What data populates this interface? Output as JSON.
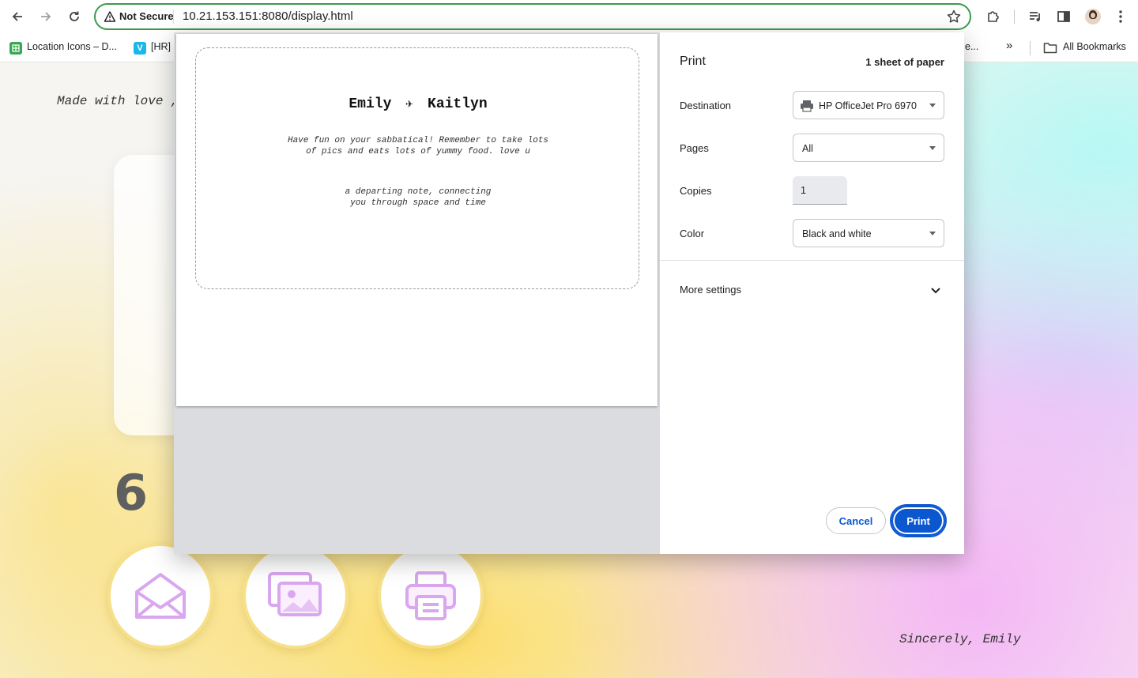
{
  "browser": {
    "security_label": "Not Secure",
    "url": "10.21.153.151:8080/display.html"
  },
  "bookmarks": {
    "items": [
      {
        "label": "Location Icons – D...",
        "favicon_letter": "",
        "color": "#34a853"
      },
      {
        "label": "[HR]",
        "favicon_letter": "V",
        "color": "#1ab7ea"
      }
    ],
    "truncated_label": "e...",
    "overflow_label": "»",
    "all_bookmarks_label": "All Bookmarks"
  },
  "page": {
    "made_with": "Made with love ,",
    "clock": "6 :",
    "sincerely": "Sincerely, Emily",
    "circle_icons": [
      "envelope-icon",
      "photos-icon",
      "printer-icon"
    ]
  },
  "print_preview": {
    "from_name": "Emily",
    "plane_glyph": "✈",
    "to_name": "Kaitlyn",
    "note": "Have fun on your sabbatical! Remember to take lots of pics and eats lots of yummy food. love u",
    "tagline_line1": "a departing note, connecting",
    "tagline_line2": "you through space and time"
  },
  "print_settings": {
    "title": "Print",
    "sheets": "1 sheet of paper",
    "destination_label": "Destination",
    "destination_value": "HP OfficeJet Pro 6970",
    "pages_label": "Pages",
    "pages_value": "All",
    "copies_label": "Copies",
    "copies_value": "1",
    "color_label": "Color",
    "color_value": "Black and white",
    "more_settings_label": "More settings",
    "cancel_label": "Cancel",
    "print_label": "Print"
  },
  "colors": {
    "accent": "#0b57d0",
    "omnibox_border": "#3c9a4d",
    "icon_purple": "#d9a6f0"
  }
}
